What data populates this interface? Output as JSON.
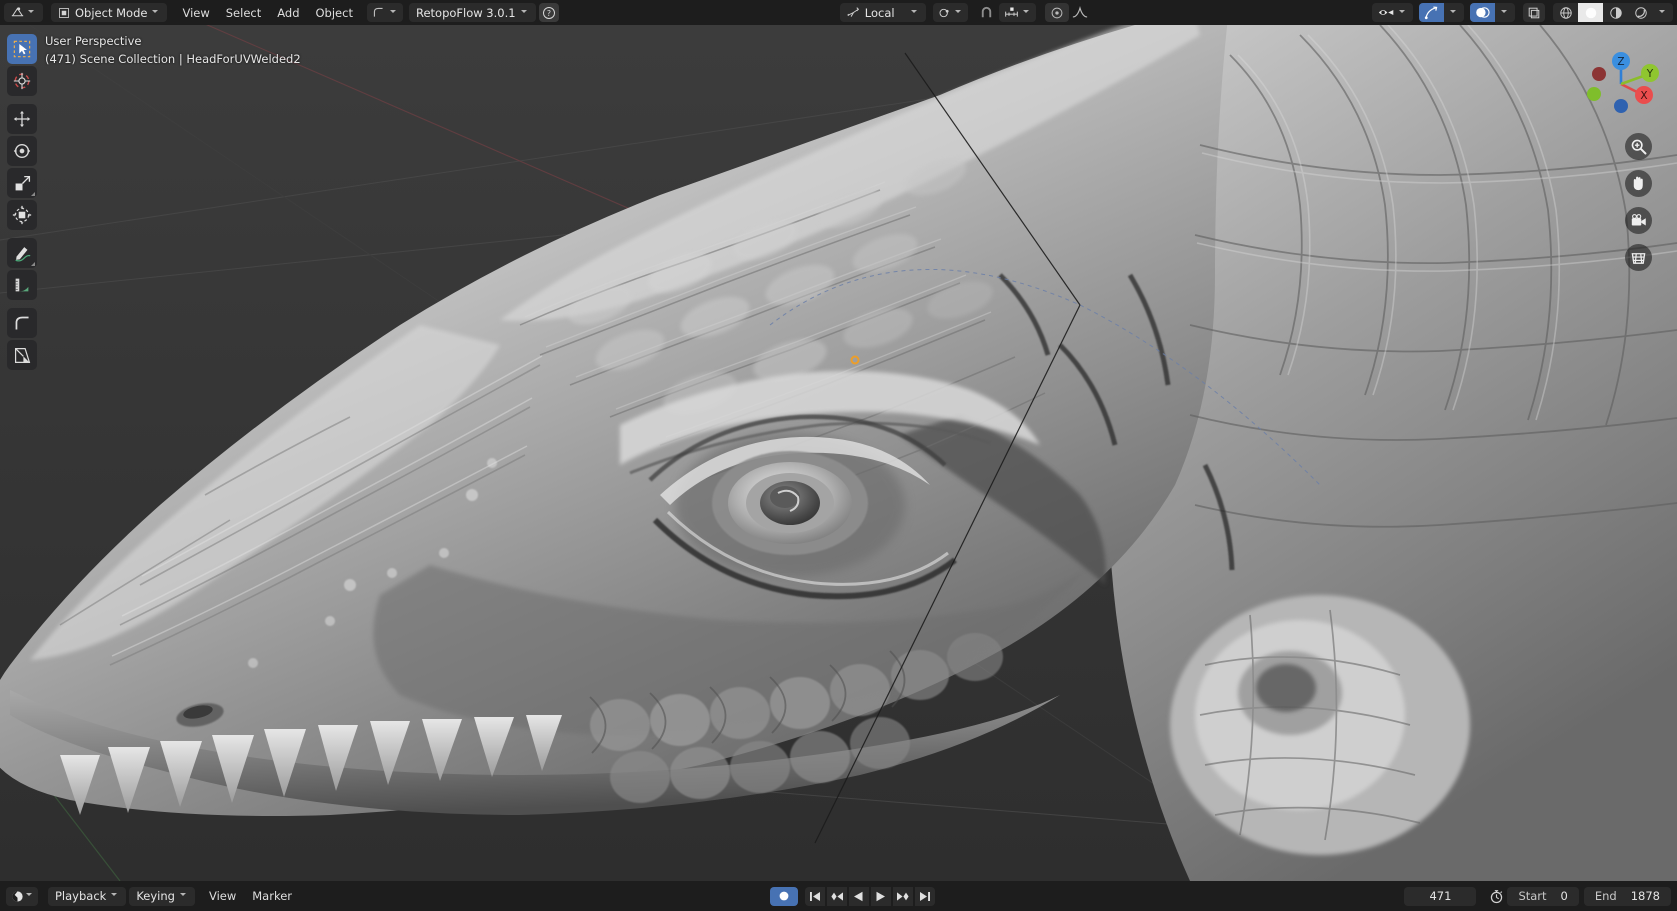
{
  "window": {
    "app": "Blender",
    "title": "3D Viewport"
  },
  "header": {
    "editor_type_icon": "editor-type-3d-viewport-icon",
    "mode": {
      "label": "Object Mode",
      "icon": "object-mode-icon"
    },
    "menus": [
      {
        "name": "view",
        "label": "View"
      },
      {
        "name": "select",
        "label": "Select"
      },
      {
        "name": "add",
        "label": "Add"
      },
      {
        "name": "object",
        "label": "Object"
      }
    ],
    "addon_menu": {
      "icon": "retopoflow-icon",
      "label": "RetopoFlow 3.0.1",
      "help_icon": "question-mark-icon"
    },
    "transform_orientation": {
      "icon": "orientation-icon",
      "label": "Local"
    },
    "pivot": {
      "icon": "pivot-point-icon"
    },
    "snap": {
      "magnet_icon": "magnet-icon",
      "snap_to_icon": "snap-increment-icon"
    },
    "proportional": {
      "toggle_icon": "proportional-editing-icon",
      "falloff_icon": "smooth-falloff-icon"
    },
    "visibility": {
      "icon": "show-hide-icon"
    },
    "gizmo": {
      "icon": "gizmo-icon",
      "active": true
    },
    "overlays": {
      "icon": "overlays-icon",
      "active": true
    },
    "xray": {
      "icon": "xray-toggle-icon"
    },
    "shading_modes": [
      {
        "name": "wireframe",
        "icon": "wireframe-shading-icon",
        "active": false
      },
      {
        "name": "solid",
        "icon": "solid-shading-icon",
        "active": true
      },
      {
        "name": "material",
        "icon": "material-preview-icon",
        "active": false
      },
      {
        "name": "rendered",
        "icon": "rendered-shading-icon",
        "active": false
      }
    ]
  },
  "viewport": {
    "perspective_label": "User Perspective",
    "scene_label": "(471) Scene Collection | HeadForUVWelded2",
    "toolbar": [
      {
        "name": "tweak-select-box",
        "icon": "select-box-icon",
        "active": true
      },
      {
        "name": "cursor",
        "icon": "3d-cursor-icon",
        "active": false
      },
      {
        "name": "move",
        "icon": "move-icon",
        "active": false
      },
      {
        "name": "rotate",
        "icon": "rotate-icon",
        "active": false
      },
      {
        "name": "scale",
        "icon": "scale-icon",
        "active": false
      },
      {
        "name": "transform",
        "icon": "transform-icon",
        "active": false
      },
      {
        "name": "annotate",
        "icon": "annotate-pencil-icon",
        "active": false
      },
      {
        "name": "measure",
        "icon": "measure-ruler-icon",
        "active": false
      },
      {
        "name": "add-cube",
        "icon": "add-primitive-icon",
        "active": false
      },
      {
        "name": "extra-tool",
        "icon": "shear-tool-icon",
        "active": false
      }
    ],
    "axis_gizmo": {
      "x": {
        "label": "X",
        "color": "#e04a4a"
      },
      "y": {
        "label": "Y",
        "color": "#8bbd2a"
      },
      "z": {
        "label": "Z",
        "color": "#2f7fd6"
      }
    },
    "nav_buttons": [
      {
        "name": "zoom-view",
        "icon": "zoom-magnifier-icon"
      },
      {
        "name": "pan-view",
        "icon": "hand-pan-icon"
      },
      {
        "name": "camera-view",
        "icon": "camera-icon"
      },
      {
        "name": "toggle-orthographic",
        "icon": "grid-ortho-icon"
      }
    ],
    "model_name": "HeadForUVWelded2"
  },
  "timeline": {
    "editor_icon": "timeline-editor-icon",
    "menus": [
      {
        "name": "playback",
        "label": "Playback",
        "has_chevron": true
      },
      {
        "name": "keying",
        "label": "Keying",
        "has_chevron": true
      },
      {
        "name": "view",
        "label": "View",
        "has_chevron": false
      },
      {
        "name": "marker",
        "label": "Marker",
        "has_chevron": false
      }
    ],
    "auto_keying": {
      "icon": "record-dot-icon",
      "active": true
    },
    "transport": [
      {
        "name": "jump-to-start",
        "icon": "jump-start-icon"
      },
      {
        "name": "previous-keyframe",
        "icon": "prev-keyframe-icon"
      },
      {
        "name": "play-reverse",
        "icon": "play-reverse-icon"
      },
      {
        "name": "play",
        "icon": "play-icon"
      },
      {
        "name": "next-keyframe",
        "icon": "next-keyframe-icon"
      },
      {
        "name": "jump-to-end",
        "icon": "jump-end-icon"
      }
    ],
    "current_frame": "471",
    "use_preview_range_icon": "stopwatch-icon",
    "start_label": "Start",
    "start_value": "0",
    "end_label": "End",
    "end_value": "1878"
  },
  "colors": {
    "accent_blue": "#4772b3",
    "header_bg": "#1d1d1d",
    "widget_bg": "#2b2b2b",
    "text": "#e4e4e4",
    "axis_x": "#e04a4a",
    "axis_y": "#8bbd2a",
    "axis_z": "#2f7fd6",
    "origin_dot": "#ed9e28"
  }
}
